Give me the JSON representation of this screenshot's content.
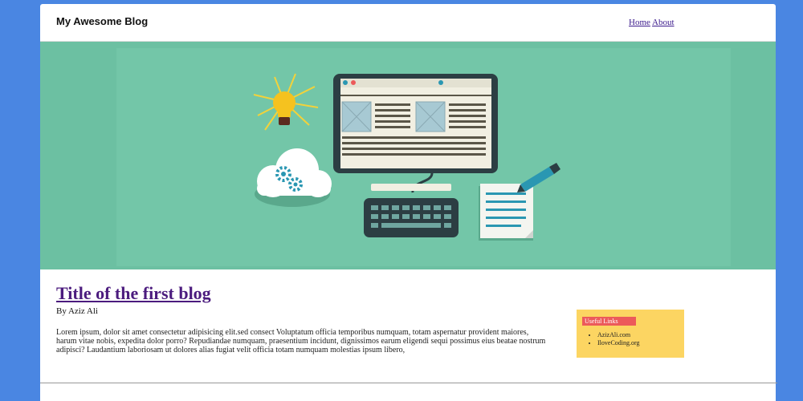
{
  "header": {
    "title": "My Awesome Blog"
  },
  "nav": {
    "items": [
      {
        "label": "Home"
      },
      {
        "label": "About"
      }
    ]
  },
  "post": {
    "title": "Title of the first blog",
    "byline": "By Aziz Ali",
    "excerpt": "Lorem ipsum, dolor sit amet consectetur adipisicing elit.sed consect Voluptatum officia temporibus numquam, totam aspernatur provident maiores, harum vitae nobis, expedita dolor porro? Repudiandae numquam, praesentium incidunt, dignissimos earum eligendi sequi possimus eius beatae nostrum adipisci? Laudantium laboriosam ut dolores alias fugiat velit officia totam numquam molestias ipsum libero,"
  },
  "sidebar": {
    "title": "Useful Links",
    "links": [
      {
        "label": "AzizAli.com"
      },
      {
        "label": "IloveCoding.org"
      }
    ]
  },
  "colors": {
    "page_background": "#4a86e2",
    "hero_background": "#6cc0a2",
    "post_title": "#4b1b7e",
    "sidebar_background": "#fcd562",
    "sidebar_title_background": "#ec5a5a"
  }
}
